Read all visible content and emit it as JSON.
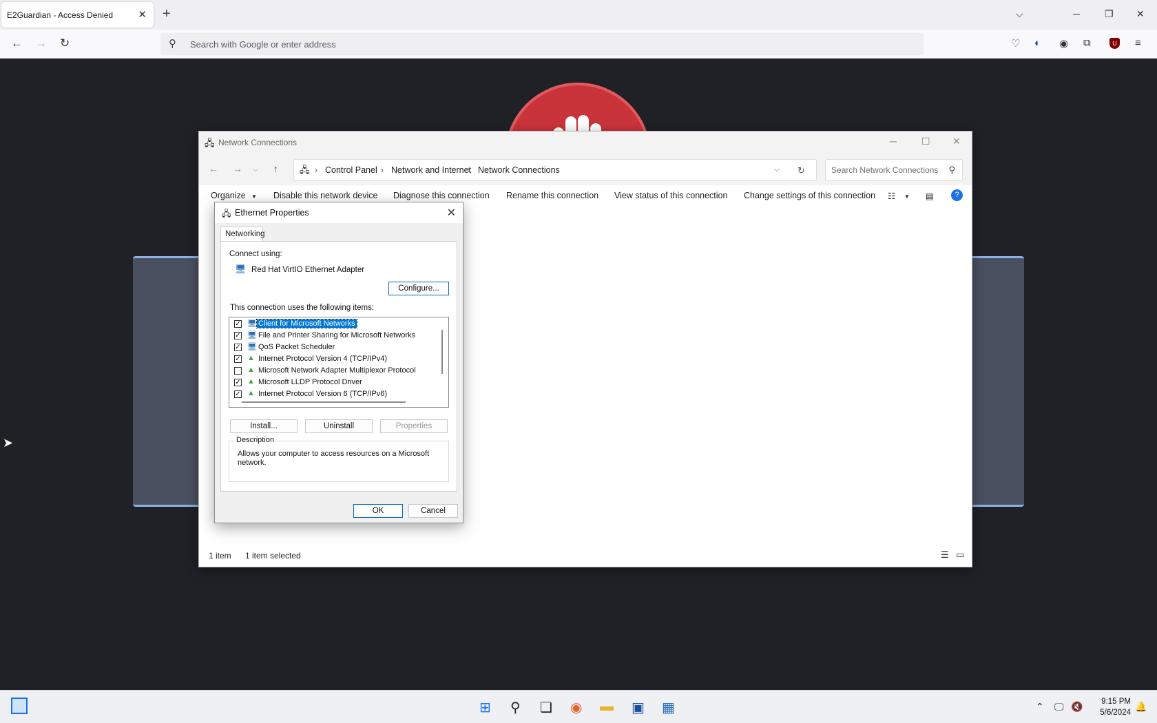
{
  "browser": {
    "tab_title": "E2Guardian - Access Denied",
    "url_placeholder": "Search with Google or enter address"
  },
  "explorer": {
    "title": "Network Connections",
    "breadcrumb": [
      "Control Panel",
      "Network and Internet",
      "Network Connections"
    ],
    "search_placeholder": "Search Network Connections",
    "commands": {
      "organize": "Organize",
      "disable": "Disable this network device",
      "diagnose": "Diagnose this connection",
      "rename": "Rename this connection",
      "view_status": "View status of this connection",
      "change_settings": "Change settings of this connection"
    },
    "status": {
      "count": "1 item",
      "selected": "1 item selected"
    }
  },
  "dialog": {
    "title": "Ethernet Properties",
    "tab": "Networking",
    "connect_using_label": "Connect using:",
    "adapter": "Red Hat VirtIO Ethernet Adapter",
    "configure": "Configure...",
    "items_label": "This connection uses the following items:",
    "items": [
      {
        "label": "Client for Microsoft Networks",
        "checked": true,
        "selected": true
      },
      {
        "label": "File and Printer Sharing for Microsoft Networks",
        "checked": true
      },
      {
        "label": "QoS Packet Scheduler",
        "checked": true
      },
      {
        "label": "Internet Protocol Version 4 (TCP/IPv4)",
        "checked": true
      },
      {
        "label": "Microsoft Network Adapter Multiplexor Protocol",
        "checked": false
      },
      {
        "label": "Microsoft LLDP Protocol Driver",
        "checked": true
      },
      {
        "label": "Internet Protocol Version 6 (TCP/IPv6)",
        "checked": true
      }
    ],
    "install": "Install...",
    "uninstall": "Uninstall",
    "properties": "Properties",
    "description_legend": "Description",
    "description": "Allows your computer to access resources on a Microsoft network.",
    "ok": "OK",
    "cancel": "Cancel"
  },
  "taskbar": {
    "time": "9:15 PM",
    "date": "5/6/2024"
  },
  "icons": {
    "accent": "#0078d7",
    "logo_red": "#c9343a"
  }
}
